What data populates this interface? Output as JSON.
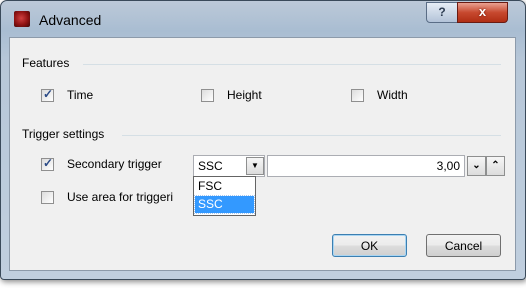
{
  "window": {
    "title": "Advanced",
    "help_label": "?",
    "close_label": "x"
  },
  "features": {
    "group_label": "Features",
    "time": {
      "label": "Time",
      "checked": true
    },
    "height": {
      "label": "Height",
      "checked": false
    },
    "width": {
      "label": "Width",
      "checked": false
    }
  },
  "trigger": {
    "group_label": "Trigger settings",
    "secondary": {
      "label": "Secondary trigger",
      "checked": true
    },
    "channel_combo": {
      "value": "SSC",
      "options": [
        "FSC",
        "SSC"
      ],
      "highlighted": "SSC"
    },
    "threshold_value": "3,00",
    "use_area": {
      "label": "Use area for triggeri",
      "checked": false
    }
  },
  "buttons": {
    "ok": "OK",
    "cancel": "Cancel"
  },
  "icons": {
    "check": "✓",
    "down": "⌄",
    "up": "⌃",
    "combo_arrow": "▼"
  }
}
